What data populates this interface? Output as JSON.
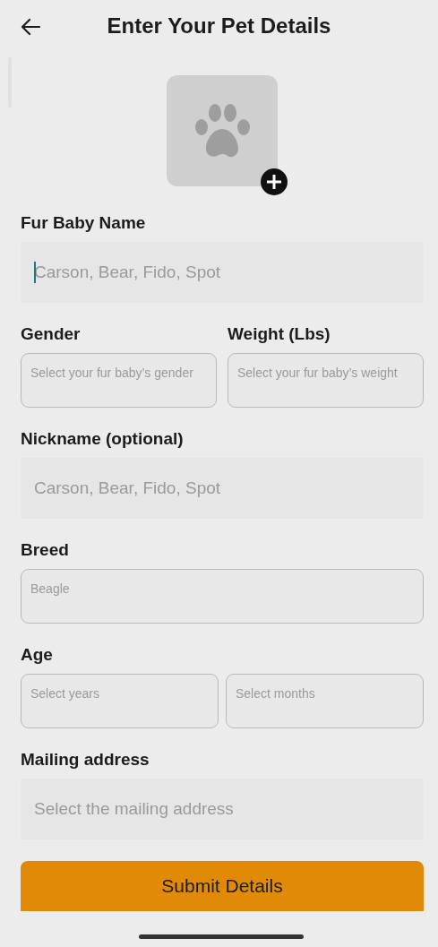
{
  "header": {
    "title": "Enter Your Pet Details"
  },
  "sections": [
    {
      "label": "Fur Baby Name",
      "fields": [
        {
          "placeholder": "Carson, Bear, Fido, Spot",
          "kind": "filled",
          "focused": true
        }
      ]
    },
    {
      "columns": [
        {
          "label": "Gender",
          "fields": [
            {
              "placeholder": "Select your fur baby’s gender",
              "kind": "outlined",
              "focused": false
            }
          ]
        },
        {
          "label": "Weight (Lbs)",
          "fields": [
            {
              "placeholder": "Select your fur baby’s weight",
              "kind": "outlined",
              "focused": false
            }
          ]
        }
      ]
    },
    {
      "label": "Nickname (optional)",
      "fields": [
        {
          "placeholder": "Carson, Bear, Fido, Spot",
          "kind": "filled",
          "focused": false
        }
      ]
    },
    {
      "label": "Breed",
      "fields": [
        {
          "placeholder": "Beagle",
          "kind": "outlined",
          "focused": false
        }
      ]
    },
    {
      "label": "Age",
      "fields": [
        {
          "placeholder": "Select years",
          "kind": "outlined",
          "focused": false
        },
        {
          "placeholder": "Select months",
          "kind": "outlined",
          "focused": false
        }
      ]
    },
    {
      "label": "Mailing address",
      "fields": [
        {
          "placeholder": "Select the mailing address",
          "kind": "filled",
          "focused": false
        }
      ]
    }
  ],
  "submit": {
    "label": "Submit Details"
  }
}
